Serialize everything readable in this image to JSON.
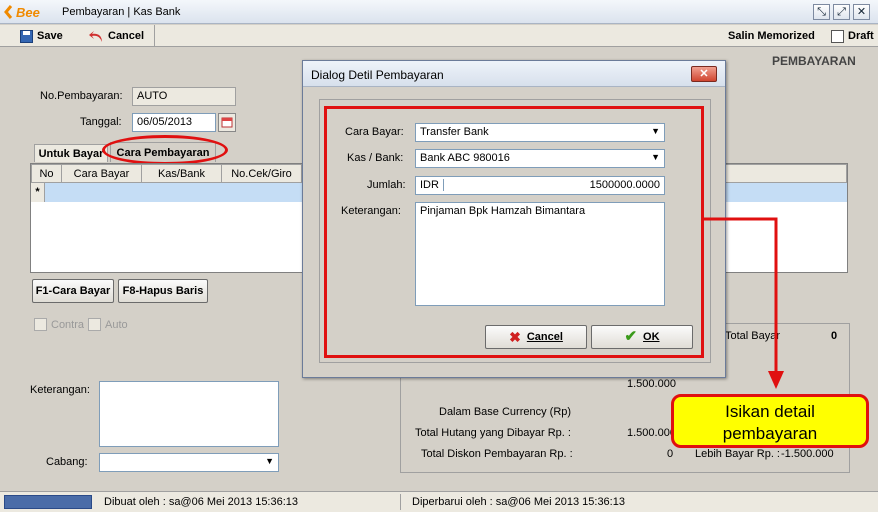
{
  "window": {
    "title": "Pembayaran | Kas Bank",
    "logo_text": "Bee"
  },
  "toolbar": {
    "save_label": "Save",
    "cancel_label": "Cancel",
    "salin_memorized_label": "Salin Memorized",
    "draft_label": "Draft"
  },
  "form": {
    "heading": "PEMBAYARAN",
    "no_pembayaran_label": "No.Pembayaran:",
    "no_pembayaran_value": "AUTO",
    "tanggal_label": "Tanggal:",
    "tanggal_value": "06/05/2013",
    "tabs": [
      "Untuk Bayar",
      "Cara Pembayaran"
    ],
    "grid_columns": [
      "No",
      "Cara Bayar",
      "Kas/Bank",
      "No.Cek/Giro"
    ],
    "grid_row_marker": "*",
    "f1_button": "F1-Cara Bayar",
    "f8_button": "F8-Hapus Baris",
    "contra_label": "Contra",
    "auto_label": "Auto",
    "keterangan_label": "Keterangan:",
    "cabang_label": "Cabang:"
  },
  "summary": {
    "total_bayar_label": "Total Bayar",
    "total_bayar_value": "0",
    "amount_value": "1.500.000",
    "base_currency_label": "Dalam Base Currency (Rp)",
    "total_hutang_label": "Total Hutang yang Dibayar Rp. :",
    "total_hutang_value": "1.500.000",
    "total_diskon_label": "Total Diskon Pembayaran Rp. :",
    "total_diskon_value": "0",
    "lebih_bayar_label": "Lebih Bayar Rp. :",
    "lebih_bayar_value": "-1.500.000"
  },
  "dialog": {
    "title": "Dialog Detil Pembayaran",
    "cara_bayar_label": "Cara Bayar:",
    "cara_bayar_value": "Transfer Bank",
    "kas_bank_label": "Kas / Bank:",
    "kas_bank_value": "Bank ABC 980016",
    "jumlah_label": "Jumlah:",
    "jumlah_currency": "IDR",
    "jumlah_value": "1500000.0000",
    "keterangan_label": "Keterangan:",
    "keterangan_value": "Pinjaman Bpk Hamzah Bimantara",
    "cancel_label": "Cancel",
    "ok_label": "OK"
  },
  "annotation": {
    "callout_line1": "Isikan detail",
    "callout_line2": "pembayaran"
  },
  "status": {
    "dibuat": "Dibuat oleh : sa@06 Mei 2013  15:36:13",
    "diperbarui": "Diperbarui oleh : sa@06 Mei 2013  15:36:13"
  },
  "colors": {
    "annotation_red": "#e01010",
    "callout_yellow": "#ffff00",
    "grid_selection": "#c5ddf5"
  }
}
